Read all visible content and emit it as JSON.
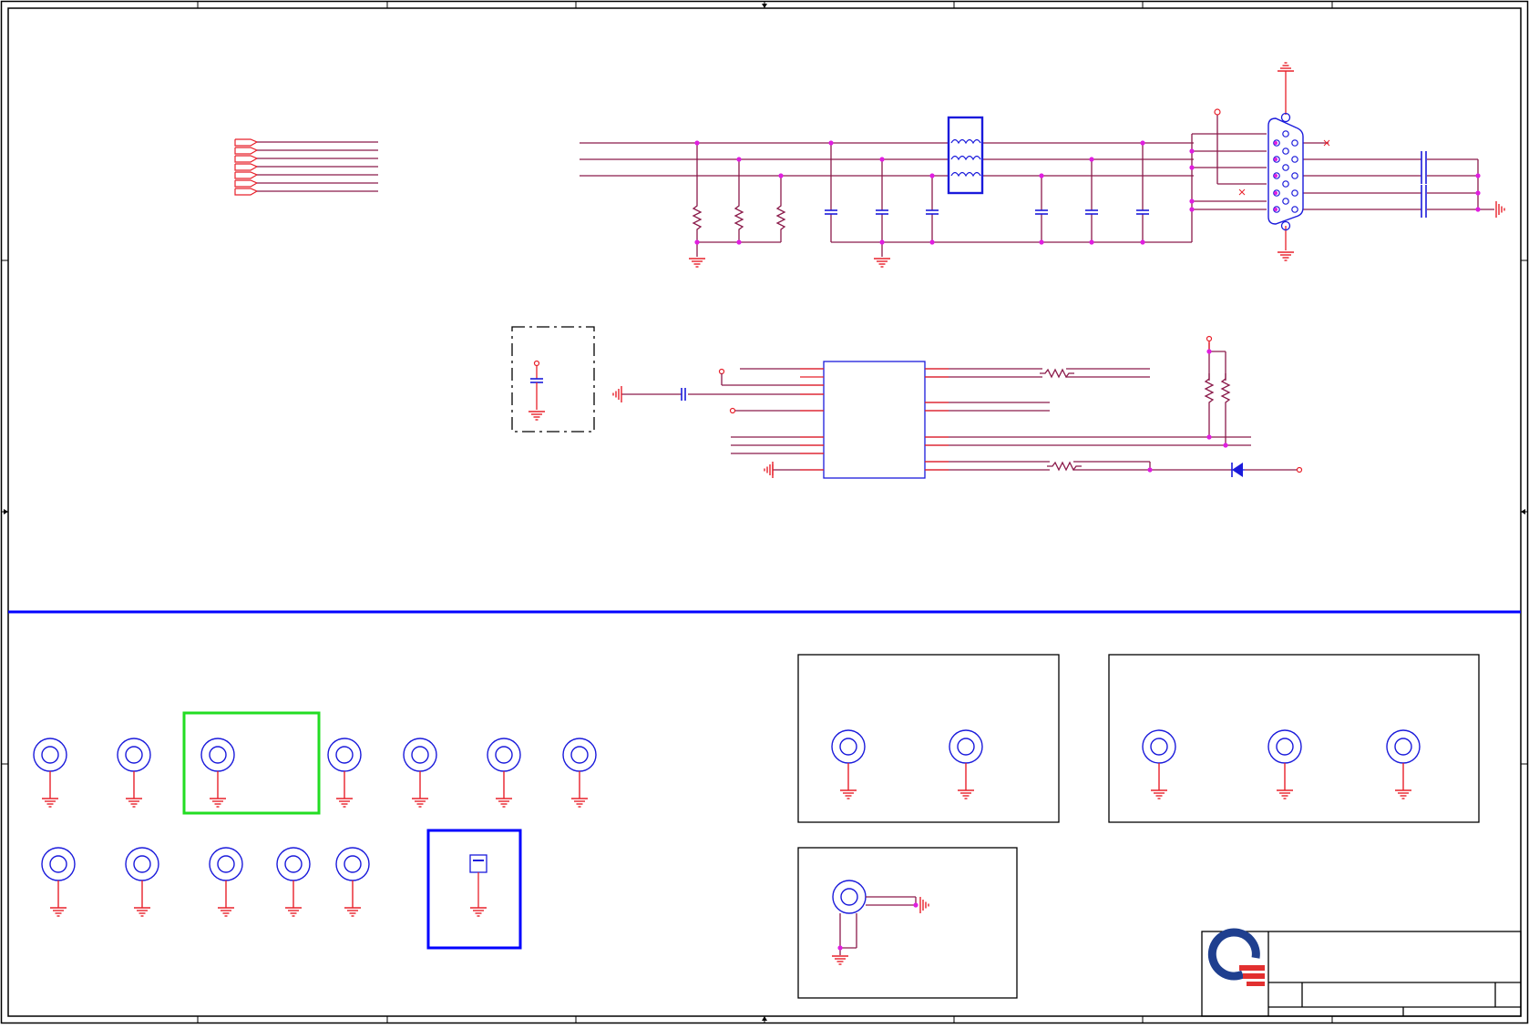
{
  "sheet": {
    "title": "",
    "colors": {
      "border": "#000000",
      "wire": "#8b1a4a",
      "pin": "#e8202a",
      "part": "#1a1adb",
      "junction": "#e01ee0",
      "divider": "#0000ff",
      "highlight_green": "#22dd22",
      "highlight_blue": "#0000ff",
      "logo_blue": "#1f3f8f",
      "logo_red": "#e23030"
    }
  },
  "icons": {
    "logo": "company-logo-icon",
    "ground": "ground-icon",
    "mounting_hole": "mounting-hole-icon",
    "connector": "db15-connector-icon",
    "ferrite": "ferrite-bead-icon",
    "resistor": "resistor-icon",
    "capacitor": "capacitor-icon",
    "diode": "diode-icon",
    "ic": "ic-chip-icon"
  },
  "title_block": {
    "title": "",
    "size": "",
    "document_number": "",
    "rev": "",
    "sheet": ""
  }
}
